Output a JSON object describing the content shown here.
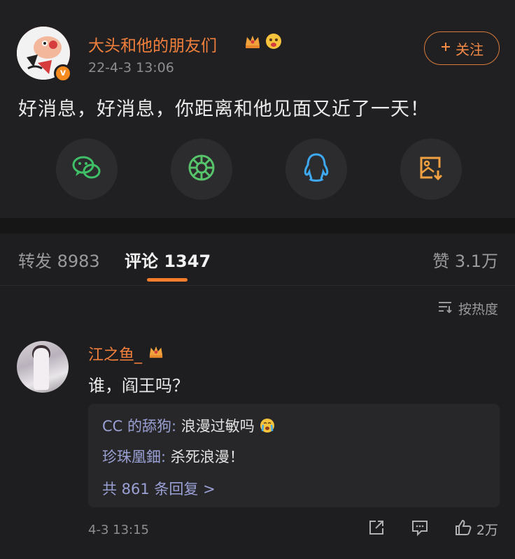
{
  "post": {
    "username": "大头和他的朋友们",
    "time": "22-4-3 13:06",
    "follow_label": "关注",
    "text": "好消息，好消息，你距离和他见面又近了一天！",
    "share_icons": [
      "wechat-icon",
      "moments-icon",
      "qq-icon",
      "save-image-icon"
    ]
  },
  "tabs": {
    "repost": "转发 8983",
    "comment": "评论 1347",
    "like": "赞 3.1万"
  },
  "sort": {
    "label": "按热度",
    "icon": "sort-icon"
  },
  "comment": {
    "username": "江之鱼_",
    "text": "谁，阎王吗？",
    "replies": [
      {
        "name": "CC 的舔狗:",
        "text": " 浪漫过敏吗"
      },
      {
        "name": "珍珠凰鈿:",
        "text": " 杀死浪漫！"
      }
    ],
    "more_replies": "共 861 条回复 >",
    "time": "4-3 13:15",
    "like_count": "2万"
  },
  "colors": {
    "accent": "#f47d2c",
    "username": "#f2803c",
    "reply_name": "#9aa0d4",
    "background": "#1e1e20"
  }
}
